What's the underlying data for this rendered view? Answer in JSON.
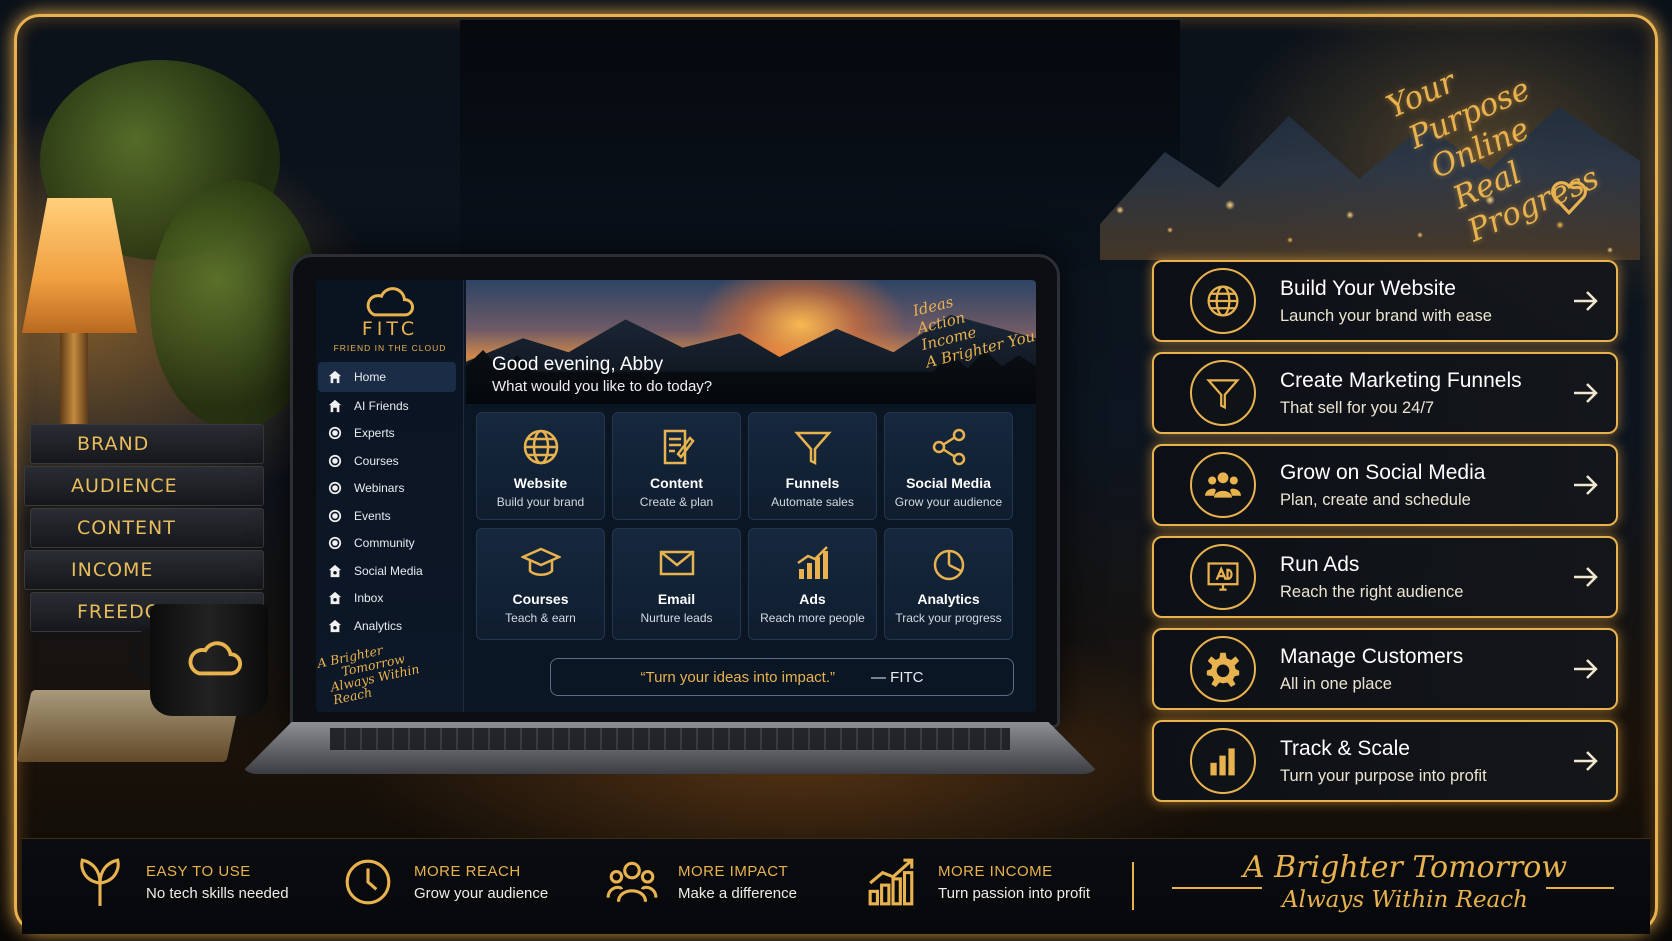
{
  "colors": {
    "accent": "#e8b24f",
    "screen_bg": "#0b1624",
    "card_bg": "#16283e",
    "active_nav": "#1b2d46"
  },
  "scene": {
    "books": [
      "BRAND",
      "AUDIENCE",
      "CONTENT",
      "INCOME",
      "FREEDOM"
    ],
    "tagline_lines": [
      "Your",
      "Purpose",
      "Online",
      "Real Progress"
    ]
  },
  "app": {
    "logo": {
      "name": "FITC",
      "subtitle": "FRIEND IN THE CLOUD",
      "icon": "cloud-icon"
    },
    "nav": [
      {
        "label": "Home",
        "icon": "home-icon",
        "active": true
      },
      {
        "label": "AI Friends",
        "icon": "home-icon"
      },
      {
        "label": "Experts",
        "icon": "target-icon"
      },
      {
        "label": "Courses",
        "icon": "target-icon"
      },
      {
        "label": "Webinars",
        "icon": "target-icon"
      },
      {
        "label": "Events",
        "icon": "target-icon"
      },
      {
        "label": "Community",
        "icon": "target-icon"
      },
      {
        "label": "Social Media",
        "icon": "house-badge-icon"
      },
      {
        "label": "Inbox",
        "icon": "house-badge-icon"
      },
      {
        "label": "Analytics",
        "icon": "house-badge-icon"
      }
    ],
    "sidebar_script": [
      "A Brighter",
      "Tomorrow",
      "Always Within Reach"
    ],
    "hero": {
      "greeting": "Good evening, Abby",
      "subtitle": "What would you like to do today?",
      "script": [
        "Ideas",
        "Action",
        "Income",
        "A Brighter You"
      ]
    },
    "cards": [
      {
        "title": "Website",
        "subtitle": "Build your brand",
        "icon": "globe-icon"
      },
      {
        "title": "Content",
        "subtitle": "Create & plan",
        "icon": "edit-document-icon"
      },
      {
        "title": "Funnels",
        "subtitle": "Automate sales",
        "icon": "funnel-icon"
      },
      {
        "title": "Social Media",
        "subtitle": "Grow your audience",
        "icon": "share-icon"
      },
      {
        "title": "Courses",
        "subtitle": "Teach & earn",
        "icon": "graduation-cap-icon"
      },
      {
        "title": "Email",
        "subtitle": "Nurture leads",
        "icon": "envelope-icon"
      },
      {
        "title": "Ads",
        "subtitle": "Reach more people",
        "icon": "bar-chart-icon"
      },
      {
        "title": "Analytics",
        "subtitle": "Track your progress",
        "icon": "pie-chart-icon"
      }
    ],
    "quote": {
      "text": "“Turn your ideas into impact.”",
      "author": "— FITC"
    }
  },
  "panels": [
    {
      "title": "Build Your Website",
      "subtitle": "Launch your brand with ease",
      "icon": "globe-icon"
    },
    {
      "title": "Create Marketing Funnels",
      "subtitle": "That sell for you 24/7",
      "icon": "funnel-icon"
    },
    {
      "title": "Grow on Social Media",
      "subtitle": "Plan, create and schedule",
      "icon": "users-icon"
    },
    {
      "title": "Run Ads",
      "subtitle": "Reach the right audience",
      "icon": "ad-monitor-icon"
    },
    {
      "title": "Manage Customers",
      "subtitle": "All in one place",
      "icon": "gear-icon"
    },
    {
      "title": "Track & Scale",
      "subtitle": "Turn your purpose into profit",
      "icon": "bar-chart-icon"
    }
  ],
  "benefits": [
    {
      "title": "EASY TO USE",
      "subtitle": "No tech skills needed",
      "icon": "sprout-icon"
    },
    {
      "title": "MORE REACH",
      "subtitle": "Grow your audience",
      "icon": "clock-icon"
    },
    {
      "title": "MORE IMPACT",
      "subtitle": "Make a difference",
      "icon": "people-icon"
    },
    {
      "title": "MORE INCOME",
      "subtitle": "Turn passion into profit",
      "icon": "growth-chart-icon"
    }
  ],
  "bottom_script": {
    "line1": "A Brighter Tomorrow",
    "line2": "Always Within Reach"
  }
}
